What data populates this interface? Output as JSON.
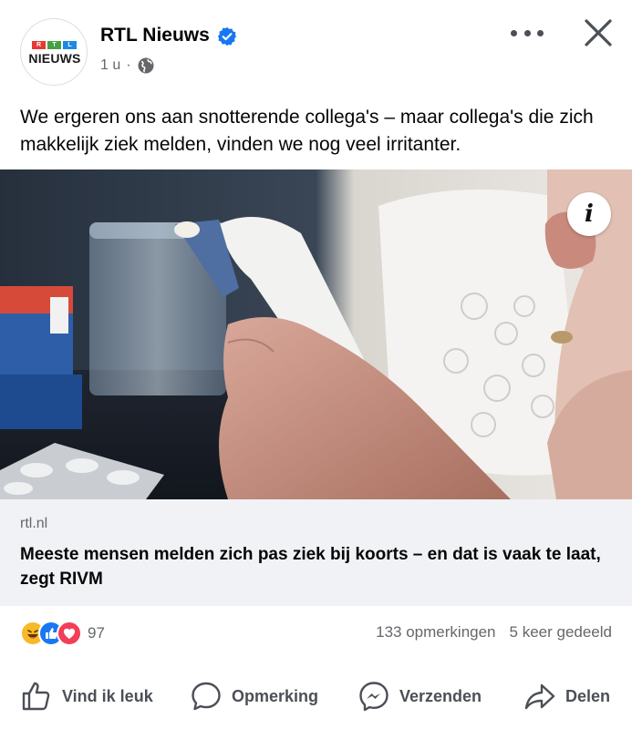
{
  "post": {
    "page_name": "RTL Nieuws",
    "time": "1 u",
    "separator": "·",
    "body_text": "We ergeren ons aan snotterende collega's – maar collega's die zich makkelijk ziek melden, vinden we nog veel irritanter."
  },
  "avatar": {
    "logo_text": "NIEUWS",
    "logo_letters": [
      "R",
      "T",
      "L"
    ]
  },
  "link_preview": {
    "domain": "rtl.nl",
    "headline": "Meeste mensen melden zich pas ziek bij koorts – en dat is vaak te laat, zegt RIVM",
    "info_button": "i"
  },
  "engagement": {
    "reaction_count": "97",
    "comments": "133 opmerkingen",
    "shares": "5 keer gedeeld",
    "reaction_icons": [
      "haha-icon",
      "like-icon",
      "love-icon"
    ]
  },
  "actions": {
    "like": "Vind ik leuk",
    "comment": "Opmerking",
    "send": "Verzenden",
    "share": "Delen"
  },
  "colors": {
    "verified": "#1877f2",
    "like_blue": "#1877f2",
    "love_red": "#f33e58",
    "haha_yellow": "#f7b928",
    "muted_text": "#65676b",
    "link_card_bg": "#f0f2f5"
  }
}
